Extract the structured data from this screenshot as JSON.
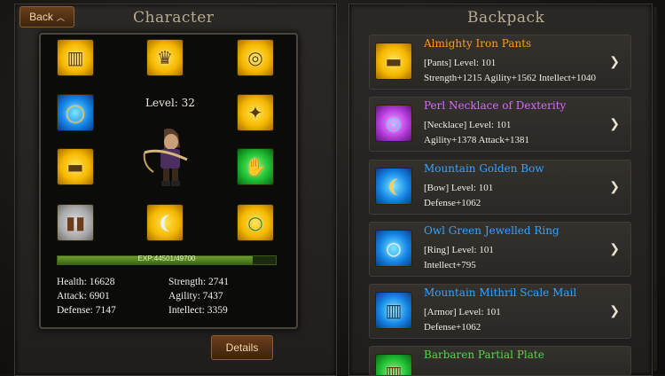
{
  "header": {
    "back_label": "Back",
    "character_title": "Character",
    "backpack_title": "Backpack"
  },
  "character": {
    "level_text": "Level: 32",
    "exp_text": "EXP:44501/49700",
    "exp_fraction": 0.895,
    "stats": {
      "health": "Health: 16628",
      "strength": "Strength: 2741",
      "attack": "Attack: 6901",
      "agility": "Agility: 7437",
      "defense": "Defense: 7147",
      "intellect": "Intellect: 3359"
    },
    "details_label": "Details",
    "slots": [
      {
        "name": "armor-slot-icon",
        "rarity": "gold",
        "glyph": "⚔"
      },
      {
        "name": "crown-slot-icon",
        "rarity": "gold",
        "glyph": "♛"
      },
      {
        "name": "necklace-slot-icon",
        "rarity": "gold",
        "glyph": "◎"
      },
      {
        "name": "belt-slot-icon",
        "rarity": "blue",
        "glyph": "◯"
      },
      {
        "name": "shoulder-slot-icon",
        "rarity": "gold",
        "glyph": "✦"
      },
      {
        "name": "pants-slot-icon",
        "rarity": "gold",
        "glyph": "▬"
      },
      {
        "name": "gloves-slot-icon",
        "rarity": "green",
        "glyph": "✋"
      },
      {
        "name": "boots-slot-icon",
        "rarity": "gray",
        "glyph": "▮"
      },
      {
        "name": "bow-slot-icon",
        "rarity": "gold",
        "glyph": "❨"
      },
      {
        "name": "ring-slot-icon",
        "rarity": "gold",
        "glyph": "○"
      }
    ]
  },
  "backpack": {
    "items": [
      {
        "name": "Almighty Iron Pants",
        "name_color": "#ff9a1f",
        "rarity": "gold",
        "icon": "pants-icon",
        "type_level": "[Pants] Level: 101",
        "stats": "Strength+1215  Agility+1562  Intellect+1040"
      },
      {
        "name": "Perl Necklace of Dexterity",
        "name_color": "#d56bff",
        "rarity": "purple",
        "icon": "necklace-icon",
        "type_level": "[Necklace] Level: 101",
        "stats": "Agility+1378  Attack+1381"
      },
      {
        "name": "Mountain Golden Bow",
        "name_color": "#35a3ff",
        "rarity": "blue",
        "icon": "bow-icon",
        "type_level": "[Bow] Level: 101",
        "stats": "Defense+1062"
      },
      {
        "name": "Owl Green Jewelled Ring",
        "name_color": "#35a3ff",
        "rarity": "blue",
        "icon": "ring-icon",
        "type_level": "[Ring] Level: 101",
        "stats": "Intellect+795"
      },
      {
        "name": "Mountain Mithril Scale Mail",
        "name_color": "#35a3ff",
        "rarity": "blue",
        "icon": "armor-icon",
        "type_level": "[Armor] Level: 101",
        "stats": "Defense+1062"
      },
      {
        "name": "Barbaren Partial Plate",
        "name_color": "#4fd84a",
        "rarity": "green",
        "icon": "plate-icon",
        "type_level": "",
        "stats": ""
      }
    ]
  }
}
